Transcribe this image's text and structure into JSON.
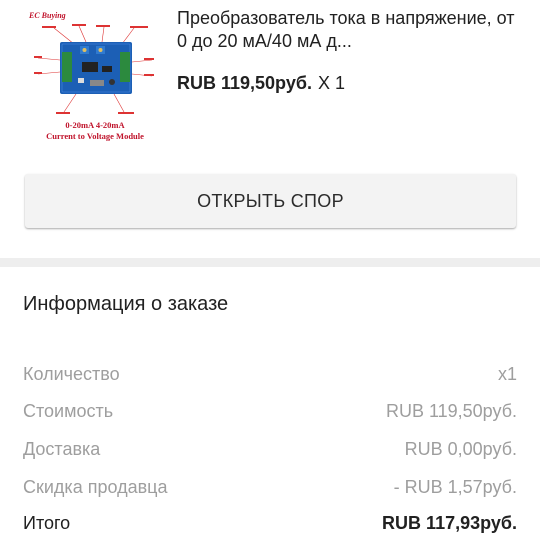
{
  "product": {
    "thumbnail": {
      "brand": "EC Buying",
      "caption_line1": "0-20mA 4-20mA",
      "caption_line2": "Current to Voltage Module"
    },
    "title": "Преобразователь тока в напряжение, от 0 до 20 мА/40 мА д...",
    "price": "RUB 119,50руб.",
    "quantity": "X 1"
  },
  "dispute_button": {
    "label": "ОТКРЫТЬ СПОР"
  },
  "order_info": {
    "title": "Информация о заказе",
    "rows": [
      {
        "label": "Количество",
        "value": "x1"
      },
      {
        "label": "Стоимость",
        "value": "RUB 119,50руб."
      },
      {
        "label": "Доставка",
        "value": "RUB 0,00руб."
      },
      {
        "label": "Скидка продавца",
        "value": "- RUB 1,57руб."
      },
      {
        "label": "Итого",
        "value": "RUB 117,93руб."
      }
    ]
  },
  "colors": {
    "text_primary": "#212121",
    "text_secondary": "#9e9e9e",
    "button_bg": "#f3f3f3",
    "divider": "#eeeeee",
    "thumbnail_caption": "#c0142c"
  }
}
